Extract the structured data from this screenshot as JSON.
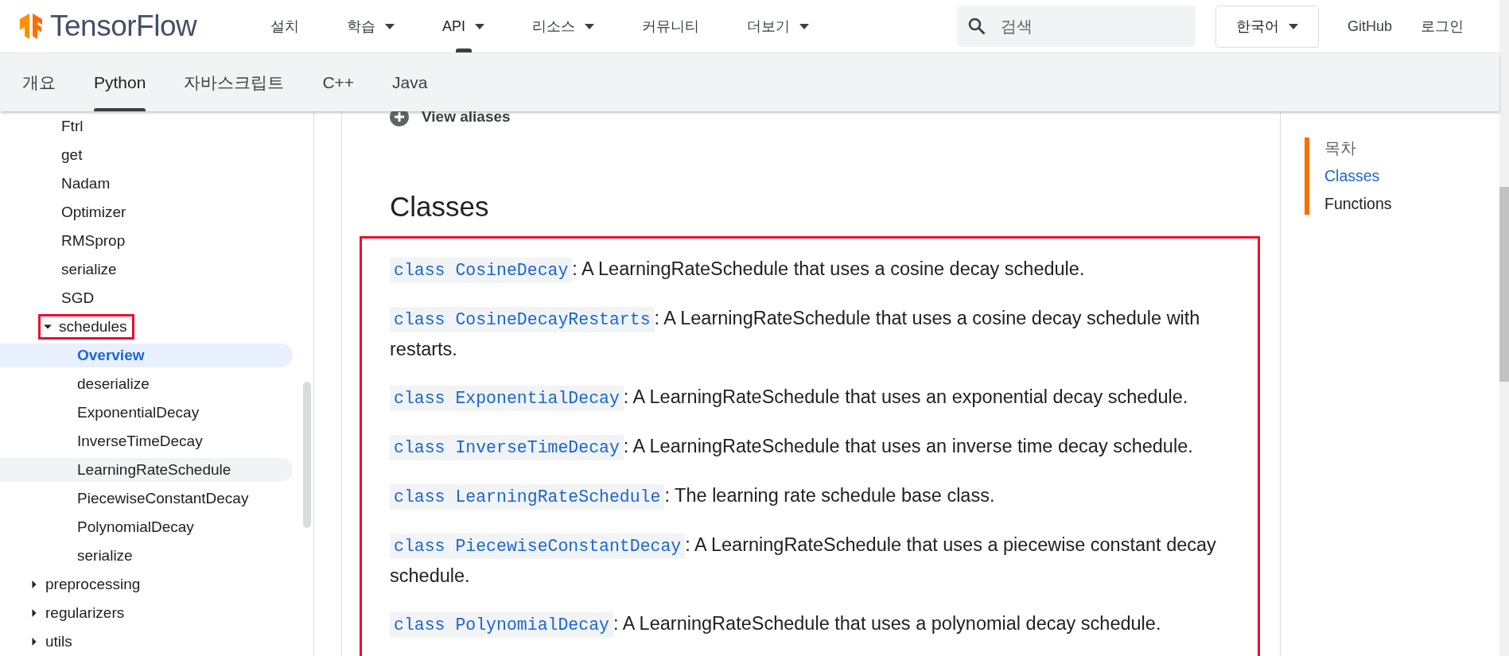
{
  "header": {
    "logo": "TensorFlow",
    "nav": [
      {
        "label": "설치",
        "dropdown": false,
        "selected": false
      },
      {
        "label": "학습",
        "dropdown": true,
        "selected": false
      },
      {
        "label": "API",
        "dropdown": true,
        "selected": true
      },
      {
        "label": "리소스",
        "dropdown": true,
        "selected": false
      },
      {
        "label": "커뮤니티",
        "dropdown": false,
        "selected": false
      },
      {
        "label": "더보기",
        "dropdown": true,
        "selected": false
      }
    ],
    "search": {
      "placeholder": "검색"
    },
    "language": "한국어",
    "links": [
      "GitHub",
      "로그인"
    ]
  },
  "subnav": {
    "tabs": [
      {
        "label": "개요",
        "selected": false
      },
      {
        "label": "Python",
        "selected": true
      },
      {
        "label": "자바스크립트",
        "selected": false
      },
      {
        "label": "C++",
        "selected": false
      },
      {
        "label": "Java",
        "selected": false
      }
    ]
  },
  "sidebar": {
    "continued_children": [
      {
        "label": "Ftrl",
        "kind": "leaf",
        "selected": false
      },
      {
        "label": "get",
        "kind": "leaf",
        "selected": false
      },
      {
        "label": "Nadam",
        "kind": "leaf",
        "selected": false
      },
      {
        "label": "Optimizer",
        "kind": "leaf",
        "selected": false
      },
      {
        "label": "RMSprop",
        "kind": "leaf",
        "selected": false
      },
      {
        "label": "serialize",
        "kind": "leaf",
        "selected": false
      },
      {
        "label": "SGD",
        "kind": "leaf",
        "selected": false
      },
      {
        "label": "schedules",
        "kind": "folder",
        "expanded": true,
        "selected": false,
        "annotated": true,
        "children": [
          {
            "label": "Overview",
            "kind": "leaf",
            "selected": true,
            "hovered": false
          },
          {
            "label": "deserialize",
            "kind": "leaf",
            "selected": false,
            "hovered": false
          },
          {
            "label": "ExponentialDecay",
            "kind": "leaf",
            "selected": false,
            "hovered": false
          },
          {
            "label": "InverseTimeDecay",
            "kind": "leaf",
            "selected": false,
            "hovered": false
          },
          {
            "label": "LearningRateSchedule",
            "kind": "leaf",
            "selected": false,
            "hovered": true
          },
          {
            "label": "PiecewiseConstantDecay",
            "kind": "leaf",
            "selected": false,
            "hovered": false
          },
          {
            "label": "PolynomialDecay",
            "kind": "leaf",
            "selected": false,
            "hovered": false
          },
          {
            "label": "serialize",
            "kind": "leaf",
            "selected": false,
            "hovered": false
          }
        ]
      }
    ],
    "items": [
      {
        "label": "preprocessing",
        "kind": "folder",
        "expanded": false,
        "selected": false
      },
      {
        "label": "regularizers",
        "kind": "folder",
        "expanded": false,
        "selected": false
      },
      {
        "label": "utils",
        "kind": "folder",
        "expanded": false,
        "selected": false
      }
    ]
  },
  "article": {
    "view_aliases": "View aliases",
    "heading": "Classes",
    "annotated": true,
    "classes": [
      {
        "code": "class CosineDecay",
        "description": ": A LearningRateSchedule that uses a cosine decay schedule."
      },
      {
        "code": "class CosineDecayRestarts",
        "description": ": A LearningRateSchedule that uses a cosine decay schedule with restarts."
      },
      {
        "code": "class ExponentialDecay",
        "description": ": A LearningRateSchedule that uses an exponential decay schedule."
      },
      {
        "code": "class InverseTimeDecay",
        "description": ": A LearningRateSchedule that uses an inverse time decay schedule."
      },
      {
        "code": "class LearningRateSchedule",
        "description": ": The learning rate schedule base class."
      },
      {
        "code": "class PiecewiseConstantDecay",
        "description": ": A LearningRateSchedule that uses a piecewise constant decay schedule."
      },
      {
        "code": "class PolynomialDecay",
        "description": ": A LearningRateSchedule that uses a polynomial decay schedule."
      }
    ]
  },
  "toc": {
    "title": "목차",
    "items": [
      {
        "label": "Classes",
        "selected": true
      },
      {
        "label": "Functions",
        "selected": false
      }
    ]
  }
}
